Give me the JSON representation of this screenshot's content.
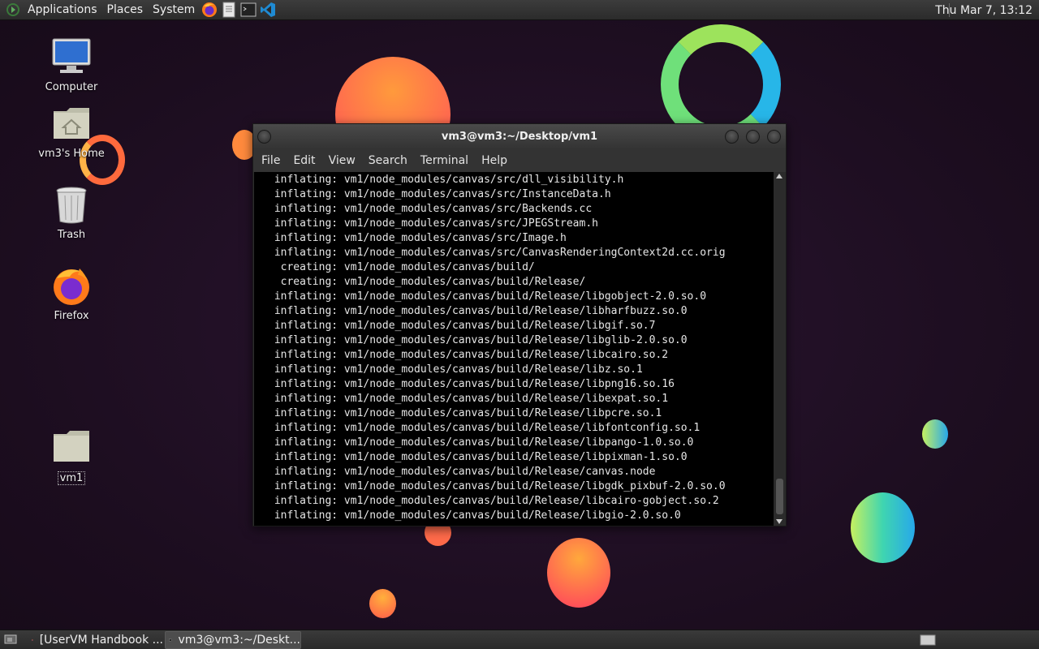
{
  "top_panel": {
    "menus": [
      "Applications",
      "Places",
      "System"
    ],
    "launchers": [
      "firefox-icon",
      "text-editor-icon",
      "terminal-icon",
      "vscode-icon"
    ],
    "clock": "Thu Mar  7, 13:12"
  },
  "desktop": {
    "icons": [
      {
        "label": "Computer",
        "icon": "computer-icon"
      },
      {
        "label": "vm3's Home",
        "icon": "home-folder-icon"
      },
      {
        "label": "Trash",
        "icon": "trash-icon"
      },
      {
        "label": "Firefox",
        "icon": "firefox-icon"
      },
      {
        "label": "vm1",
        "icon": "folder-icon"
      }
    ]
  },
  "terminal": {
    "title": "vm3@vm3:~/Desktop/vm1",
    "menu": [
      "File",
      "Edit",
      "View",
      "Search",
      "Terminal",
      "Help"
    ],
    "lines": [
      " inflating: vm1/node_modules/canvas/src/dll_visibility.h",
      " inflating: vm1/node_modules/canvas/src/InstanceData.h",
      " inflating: vm1/node_modules/canvas/src/Backends.cc",
      " inflating: vm1/node_modules/canvas/src/JPEGStream.h",
      " inflating: vm1/node_modules/canvas/src/Image.h",
      " inflating: vm1/node_modules/canvas/src/CanvasRenderingContext2d.cc.orig",
      "  creating: vm1/node_modules/canvas/build/",
      "  creating: vm1/node_modules/canvas/build/Release/",
      " inflating: vm1/node_modules/canvas/build/Release/libgobject-2.0.so.0",
      " inflating: vm1/node_modules/canvas/build/Release/libharfbuzz.so.0",
      " inflating: vm1/node_modules/canvas/build/Release/libgif.so.7",
      " inflating: vm1/node_modules/canvas/build/Release/libglib-2.0.so.0",
      " inflating: vm1/node_modules/canvas/build/Release/libcairo.so.2",
      " inflating: vm1/node_modules/canvas/build/Release/libz.so.1",
      " inflating: vm1/node_modules/canvas/build/Release/libpng16.so.16",
      " inflating: vm1/node_modules/canvas/build/Release/libexpat.so.1",
      " inflating: vm1/node_modules/canvas/build/Release/libpcre.so.1",
      " inflating: vm1/node_modules/canvas/build/Release/libfontconfig.so.1",
      " inflating: vm1/node_modules/canvas/build/Release/libpango-1.0.so.0",
      " inflating: vm1/node_modules/canvas/build/Release/libpixman-1.so.0",
      " inflating: vm1/node_modules/canvas/build/Release/canvas.node",
      " inflating: vm1/node_modules/canvas/build/Release/libgdk_pixbuf-2.0.so.0",
      " inflating: vm1/node_modules/canvas/build/Release/libcairo-gobject.so.2",
      " inflating: vm1/node_modules/canvas/build/Release/libgio-2.0.so.0"
    ]
  },
  "taskbar": {
    "tasks": [
      {
        "label": "[UserVM Handbook ...",
        "icon": "firefox-icon",
        "active": false
      },
      {
        "label": "vm3@vm3:~/Deskt...",
        "icon": "terminal-icon",
        "active": true
      }
    ]
  }
}
